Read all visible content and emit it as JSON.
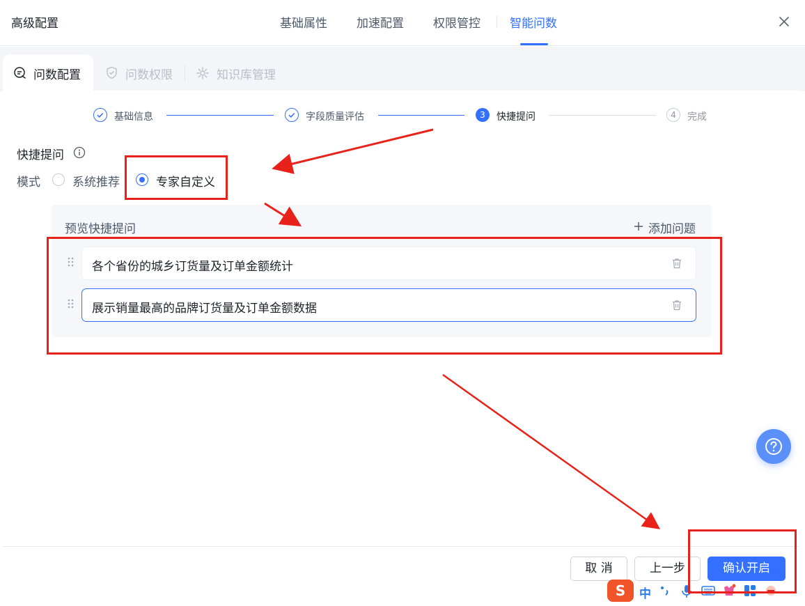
{
  "header": {
    "title": "高级配置",
    "tabs": [
      {
        "label": "基础属性",
        "active": false
      },
      {
        "label": "加速配置",
        "active": false
      },
      {
        "label": "权限管控",
        "active": false
      },
      {
        "label": "智能问数",
        "active": true
      }
    ]
  },
  "subtabs": [
    {
      "label": "问数配置",
      "icon": "chat-icon",
      "active": true
    },
    {
      "label": "问数权限",
      "icon": "shield-check-icon",
      "active": false
    },
    {
      "label": "知识库管理",
      "icon": "gear-icon",
      "active": false
    }
  ],
  "steps": [
    {
      "num": "1",
      "label": "基础信息",
      "status": "done"
    },
    {
      "num": "2",
      "label": "字段质量评估",
      "status": "done"
    },
    {
      "num": "3",
      "label": "快捷提问",
      "status": "current"
    },
    {
      "num": "4",
      "label": "完成",
      "status": "pending"
    }
  ],
  "section": {
    "title": "快捷提问",
    "mode_label": "模式",
    "options": [
      {
        "label": "系统推荐",
        "selected": false
      },
      {
        "label": "专家自定义",
        "selected": true
      }
    ]
  },
  "preview": {
    "title": "预览快捷提问",
    "add_label": "添加问题",
    "questions": [
      "各个省份的城乡订货量及订单金额统计",
      "展示销量最高的品牌订货量及订单金额数据"
    ]
  },
  "footer": {
    "cancel": "取 消",
    "prev": "上一步",
    "confirm": "确认开启"
  },
  "ime": {
    "logo": "S",
    "lang": "中"
  },
  "colors": {
    "accent": "#3370ff",
    "annotation": "#e8221b",
    "fab": "#5b8ff9"
  }
}
